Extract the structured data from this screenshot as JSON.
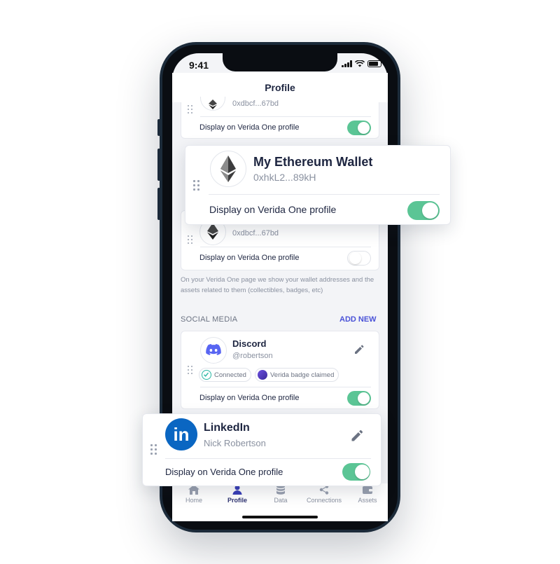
{
  "status_bar": {
    "time": "9:41"
  },
  "header": {
    "title": "Profile"
  },
  "wallets": {
    "top_partial": {
      "address": "0xdbcf...67bd",
      "display_label": "Display on Verida One profile",
      "toggle_on": true
    },
    "featured": {
      "name": "My Ethereum Wallet",
      "address": "0xhkL2...89kH",
      "display_label": "Display on Verida One profile",
      "toggle_on": true
    },
    "third": {
      "address": "0xdbcf...67bd",
      "display_label": "Display on Verida One profile",
      "toggle_on": false
    },
    "info": "On your Verida One page we show your wallet addresses and the assets related to them (collectibles, badges, etc)"
  },
  "social": {
    "section_title": "SOCIAL MEDIA",
    "add_new": "ADD NEW",
    "discord": {
      "name": "Discord",
      "handle": "@robertson",
      "badges": [
        "Connected",
        "Verida badge claimed"
      ],
      "display_label": "Display on Verida One profile",
      "toggle_on": true
    },
    "linkedin": {
      "name": "LinkedIn",
      "handle": "Nick Robertson",
      "logo_text": "in",
      "display_label": "Display on Verida One profile",
      "toggle_on": true
    }
  },
  "tabs": [
    {
      "label": "Home",
      "icon": "home-icon"
    },
    {
      "label": "Profile",
      "icon": "user-icon"
    },
    {
      "label": "Data",
      "icon": "database-icon"
    },
    {
      "label": "Connections",
      "icon": "share-icon"
    },
    {
      "label": "Assets",
      "icon": "wallet-icon"
    }
  ],
  "colors": {
    "toggle_on": "#5bc595",
    "accent": "#4a52d8",
    "discord": "#5865f2",
    "linkedin": "#0a66c2",
    "text": "#1d2540"
  }
}
